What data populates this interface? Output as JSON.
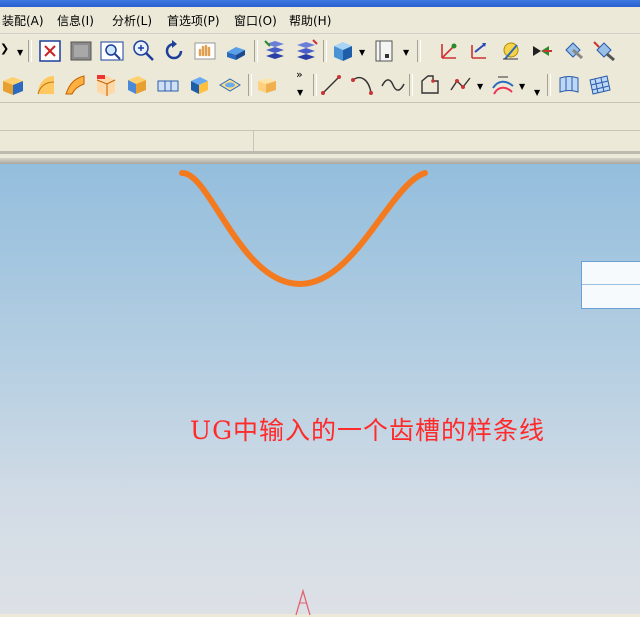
{
  "menubar": {
    "items": [
      {
        "label": "装配(A)"
      },
      {
        "label": "信息(I)"
      },
      {
        "label": "分析(L)"
      },
      {
        "label": "首选项(P)"
      },
      {
        "label": "窗口(O)"
      },
      {
        "label": "帮助(H)"
      }
    ]
  },
  "toolbar_row1": {
    "icons": [
      "fit-view-icon",
      "shaded-view-icon",
      "zoom-window-icon",
      "zoom-icon",
      "rotate-icon",
      "pan-icon",
      "isometric-view-icon",
      "layer-settings-icon",
      "layer-move-icon",
      "render-style-icon",
      "view-orient-icon",
      "point-constructor-icon",
      "vector-icon",
      "sketch-icon",
      "plane-icon",
      "csys-icon",
      "datum-icon"
    ]
  },
  "toolbar_row2": {
    "icons": [
      "extrude-icon",
      "revolve-icon",
      "sweep-icon",
      "tube-icon",
      "block-icon",
      "cylinder-icon",
      "cone-icon",
      "sphere-icon",
      "hole-icon",
      "line-icon",
      "arc-icon",
      "spline-icon",
      "polygon-icon",
      "curve-edit-icon",
      "offset-curve-icon",
      "surface-icon",
      "mesh-surface-icon"
    ],
    "overflow_label": "»"
  },
  "viewport": {
    "annotation": "UG中输入的一个齿槽的样条线",
    "colors": {
      "curve": "#f47a1f",
      "annotation": "#ff2a2a",
      "bg_top": "#94bedd",
      "bg_bottom": "#dde1e6"
    }
  }
}
